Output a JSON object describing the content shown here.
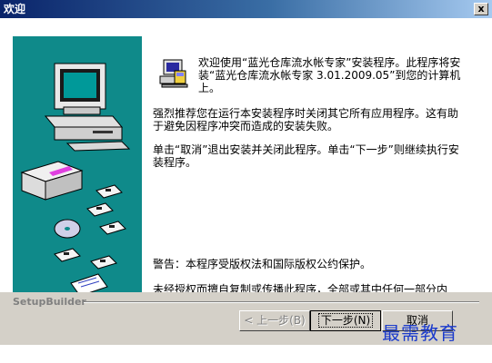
{
  "window": {
    "title": "欢迎",
    "close_label": "x"
  },
  "content": {
    "intro": "欢迎使用“蓝光仓库流水帐专家”安装程序。此程序将安装“蓝光仓库流水帐专家 3.01.2009.05”到您的计算机上。",
    "recommend": "强烈推荐您在运行本安装程序时关闭其它所有应用程序。这有助于避免因程序冲突而造成的安装失败。",
    "instructions": "单击“取消”退出安装并关闭此程序。单击“下一步”则继续执行安装程序。",
    "warning": "警告：本程序受版权法和国际版权公约保护。",
    "legal": "未经授权而擅自复制或传播此程序，全部或其中任何一部分内容。将依法追究其责任，并将按法律允许范围内的最大可能来起诉。"
  },
  "footer": {
    "brand": "SetupBuilder",
    "back_label": "< 上一步(B)",
    "next_label": "下一步(N)",
    "cancel_label": "取消"
  },
  "watermark": "最需教育",
  "colors": {
    "title_start": "#0a246a",
    "title_end": "#a6caf0",
    "art_bg": "#0f8a8a",
    "face": "#d4d0c8",
    "watermark": "#1a3acc"
  }
}
